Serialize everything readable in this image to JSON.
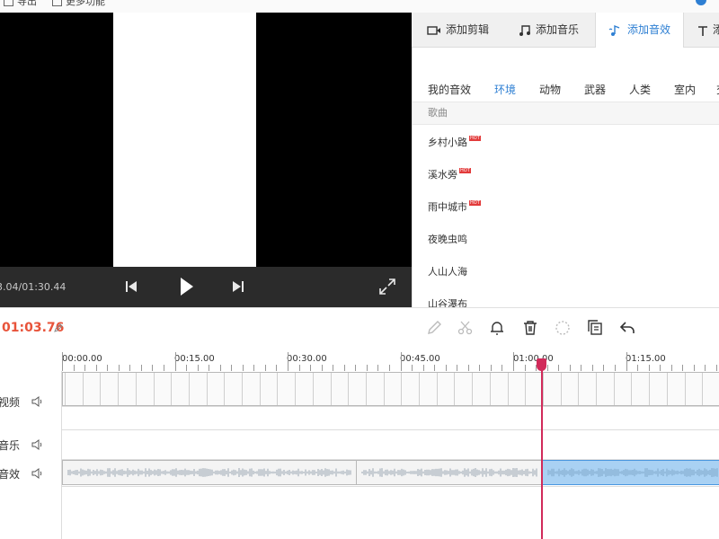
{
  "topbar": {
    "item1": "导出",
    "item2": "更多功能"
  },
  "preview": {
    "timecode": "3.04/01:30.44"
  },
  "tabs": [
    {
      "label": "添加剪辑",
      "icon": "video-camera-icon"
    },
    {
      "label": "添加音乐",
      "icon": "music-note-icon"
    },
    {
      "label": "添加音效",
      "icon": "sound-effect-icon",
      "active": true
    },
    {
      "label": "添",
      "icon": "text-icon"
    }
  ],
  "categories": [
    "我的音效",
    "环境",
    "动物",
    "武器",
    "人类",
    "室内",
    "交"
  ],
  "active_category": "环境",
  "list_header": "歌曲",
  "songs": [
    {
      "name": "乡村小路",
      "hot": true
    },
    {
      "name": "溪水旁",
      "hot": true
    },
    {
      "name": "雨中城市",
      "hot": true
    },
    {
      "name": "夜晚虫鸣",
      "hot": false
    },
    {
      "name": "人山人海",
      "hot": false
    },
    {
      "name": "山谷瀑布",
      "hot": false
    }
  ],
  "hot_badge": "HOT",
  "toolbar": {
    "current_time": "01:03.76"
  },
  "ruler": {
    "labels": [
      "00:00.00",
      "00:15.00",
      "00:30.00",
      "00:45.00",
      "01:00.00",
      "01:15.00"
    ]
  },
  "tracks": {
    "video": "视频",
    "music": "音乐",
    "sfx": "音效"
  },
  "colors": {
    "accent": "#2e7fd3",
    "time": "#e8533a",
    "playhead": "#d12a5a",
    "hot": "#e23b3b",
    "selected_clip": "#a9d1f3"
  }
}
